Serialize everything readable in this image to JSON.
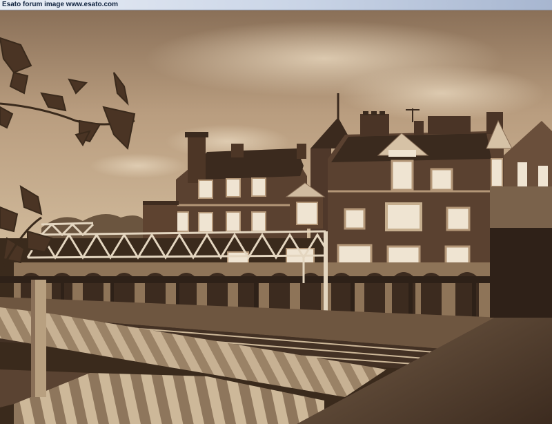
{
  "caption": {
    "text": "Esato forum image www.esato.com"
  },
  "photo": {
    "tone": "sepia",
    "palette": {
      "sky_light": "#cbb496",
      "sky_dark": "#8a7058",
      "brick": "#5e4330",
      "brick_dark": "#3f2c1f",
      "stone": "#b39677",
      "window": "#efe4d2",
      "steel": "#d8c8b2",
      "roof_dark": "#2e2118",
      "foliage": "#4a3424"
    }
  }
}
